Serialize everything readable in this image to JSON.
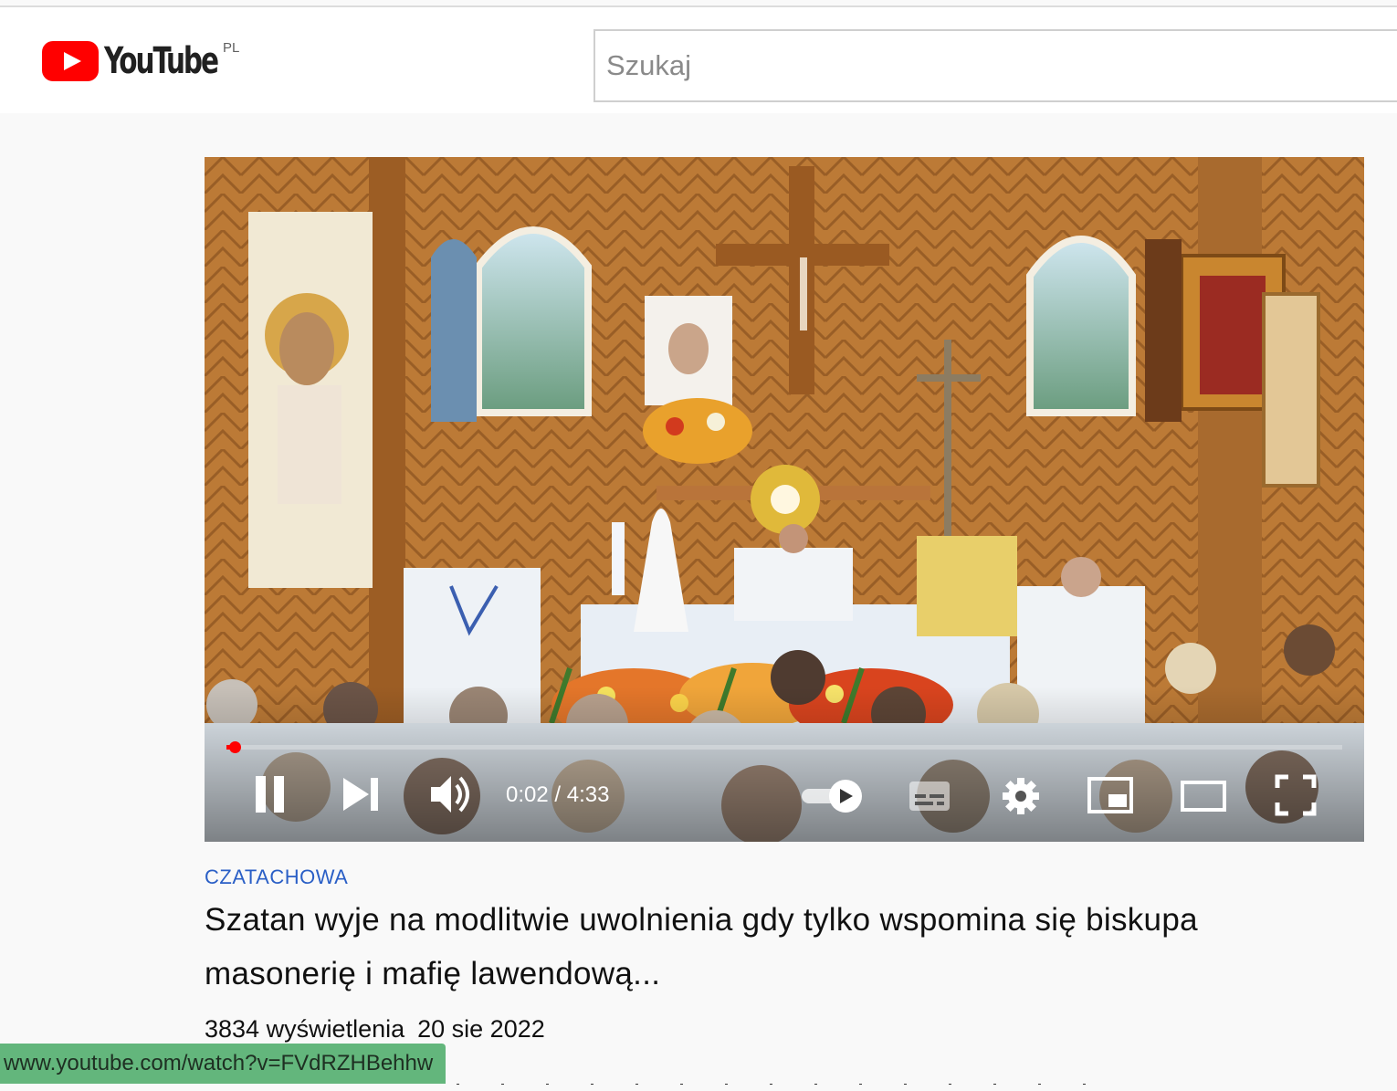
{
  "header": {
    "logo_text": "YouTube",
    "country_code": "PL",
    "search_placeholder": "Szukaj"
  },
  "player": {
    "state": "playing",
    "time_display": "0:02 / 4:33",
    "progress_fraction": 0.007,
    "autoplay": "on",
    "controls": [
      "pause-icon",
      "next-icon",
      "volume-icon",
      "autoplay-toggle",
      "subtitles-icon",
      "settings-gear-icon",
      "miniplayer-icon",
      "theater-mode-icon",
      "fullscreen-icon"
    ],
    "colors": {
      "progress": "#ff0000",
      "brand_red": "#ff0000"
    }
  },
  "video": {
    "channel": "CZATACHOWA",
    "title": "Szatan wyje na modlitwie uwolnienia gdy tylko wspomina się biskupa masonerię i mafię lawendową...",
    "views": "3834 wyświetlenia",
    "date": "20 sie 2022"
  },
  "status_bar": {
    "url": "www.youtube.com/watch?v=FVdRZHBehhw"
  }
}
